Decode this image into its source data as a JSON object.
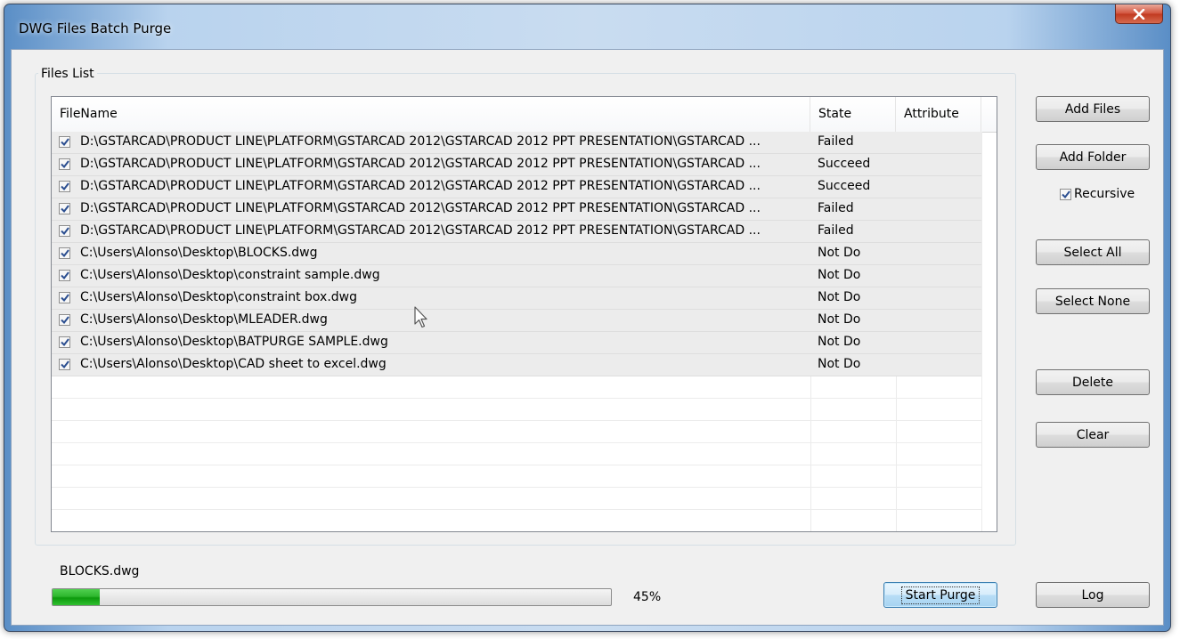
{
  "window": {
    "title": "DWG Files Batch Purge"
  },
  "files_group": {
    "label": "Files List"
  },
  "list": {
    "columns": {
      "filename": "FileName",
      "state": "State",
      "attribute": "Attribute"
    },
    "rows": [
      {
        "checked": true,
        "filename": "D:\\GSTARCAD\\PRODUCT LINE\\PLATFORM\\GSTARCAD 2012\\GSTARCAD 2012 PPT PRESENTATION\\GSTARCAD ...",
        "state": "Failed"
      },
      {
        "checked": true,
        "filename": "D:\\GSTARCAD\\PRODUCT LINE\\PLATFORM\\GSTARCAD 2012\\GSTARCAD 2012 PPT PRESENTATION\\GSTARCAD ...",
        "state": "Succeed"
      },
      {
        "checked": true,
        "filename": "D:\\GSTARCAD\\PRODUCT LINE\\PLATFORM\\GSTARCAD 2012\\GSTARCAD 2012 PPT PRESENTATION\\GSTARCAD ...",
        "state": "Succeed"
      },
      {
        "checked": true,
        "filename": "D:\\GSTARCAD\\PRODUCT LINE\\PLATFORM\\GSTARCAD 2012\\GSTARCAD 2012 PPT PRESENTATION\\GSTARCAD ...",
        "state": "Failed"
      },
      {
        "checked": true,
        "filename": "D:\\GSTARCAD\\PRODUCT LINE\\PLATFORM\\GSTARCAD 2012\\GSTARCAD 2012 PPT PRESENTATION\\GSTARCAD ...",
        "state": "Failed"
      },
      {
        "checked": true,
        "filename": "C:\\Users\\Alonso\\Desktop\\BLOCKS.dwg",
        "state": "Not Do"
      },
      {
        "checked": true,
        "filename": "C:\\Users\\Alonso\\Desktop\\constraint sample.dwg",
        "state": "Not Do"
      },
      {
        "checked": true,
        "filename": "C:\\Users\\Alonso\\Desktop\\constraint box.dwg",
        "state": "Not Do"
      },
      {
        "checked": true,
        "filename": "C:\\Users\\Alonso\\Desktop\\MLEADER.dwg",
        "state": "Not Do"
      },
      {
        "checked": true,
        "filename": "C:\\Users\\Alonso\\Desktop\\BATPURGE SAMPLE.dwg",
        "state": "Not Do"
      },
      {
        "checked": true,
        "filename": "C:\\Users\\Alonso\\Desktop\\CAD sheet to excel.dwg",
        "state": "Not Do"
      }
    ]
  },
  "buttons": {
    "add_files": "Add Files",
    "add_folder": "Add Folder",
    "select_all": "Select All",
    "select_none": "Select None",
    "delete": "Delete",
    "clear": "Clear",
    "start_purge": "Start Purge",
    "log": "Log"
  },
  "recursive": {
    "label": "Recursive",
    "checked": true
  },
  "progress": {
    "current_file": "BLOCKS.dwg",
    "percent_label": "45%",
    "fill_fraction": 0.085
  },
  "colors": {
    "progress_green": "#2eb72e",
    "close_red": "#c0391f"
  },
  "icons": {
    "close": "close-icon",
    "checkbox": "checkmark-icon",
    "cursor": "mouse-pointer-icon"
  }
}
